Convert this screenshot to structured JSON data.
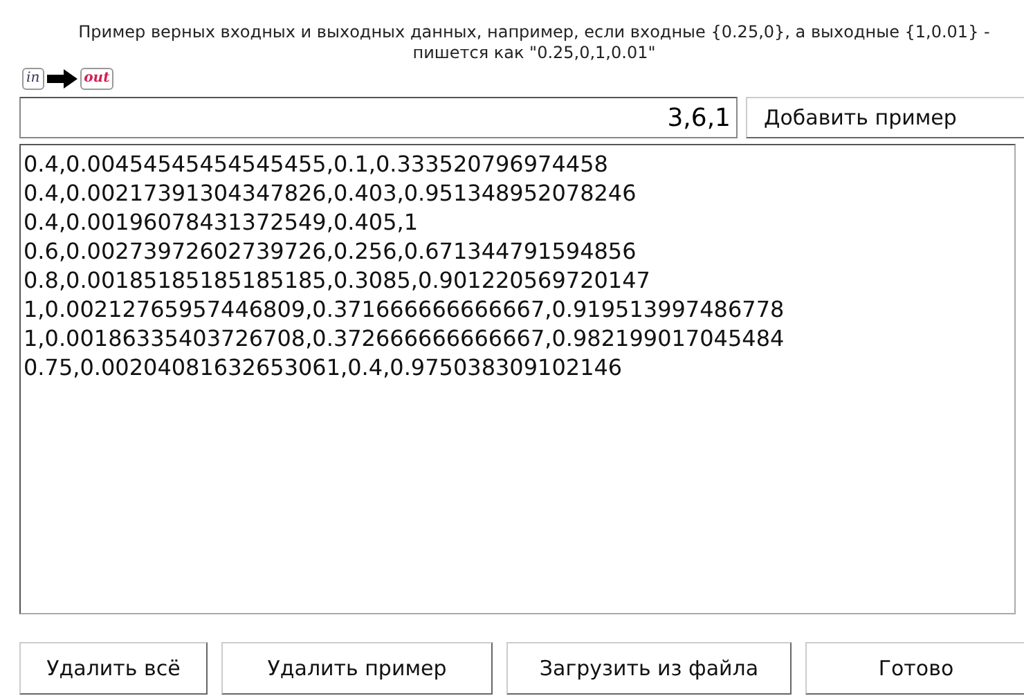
{
  "hint": {
    "text": "Пример верных входных и выходных данных, например, если входные {0.25,0}, а выходные {1,0.01} - пишется как \"0.25,0,1,0.01\"",
    "in_label": "in",
    "out_label": "out"
  },
  "entry": {
    "value": "3,6,1",
    "add_button": "Добавить пример"
  },
  "examples": [
    "0.4,0.00454545454545455,0.1,0.333520796974458",
    "0.4,0.00217391304347826,0.403,0.951348952078246",
    "0.4,0.00196078431372549,0.405,1",
    "0.6,0.00273972602739726,0.256,0.671344791594856",
    "0.8,0.00185185185185185,0.3085,0.901220569720147",
    "1,0.00212765957446809,0.371666666666667,0.919513997486778",
    "1,0.00186335403726708,0.372666666666667,0.982199017045484",
    "0.75,0.00204081632653061,0.4,0.975038309102146"
  ],
  "buttons": [
    "Удалить всё",
    "Удалить пример",
    "Загрузить из файла",
    "Готово"
  ]
}
